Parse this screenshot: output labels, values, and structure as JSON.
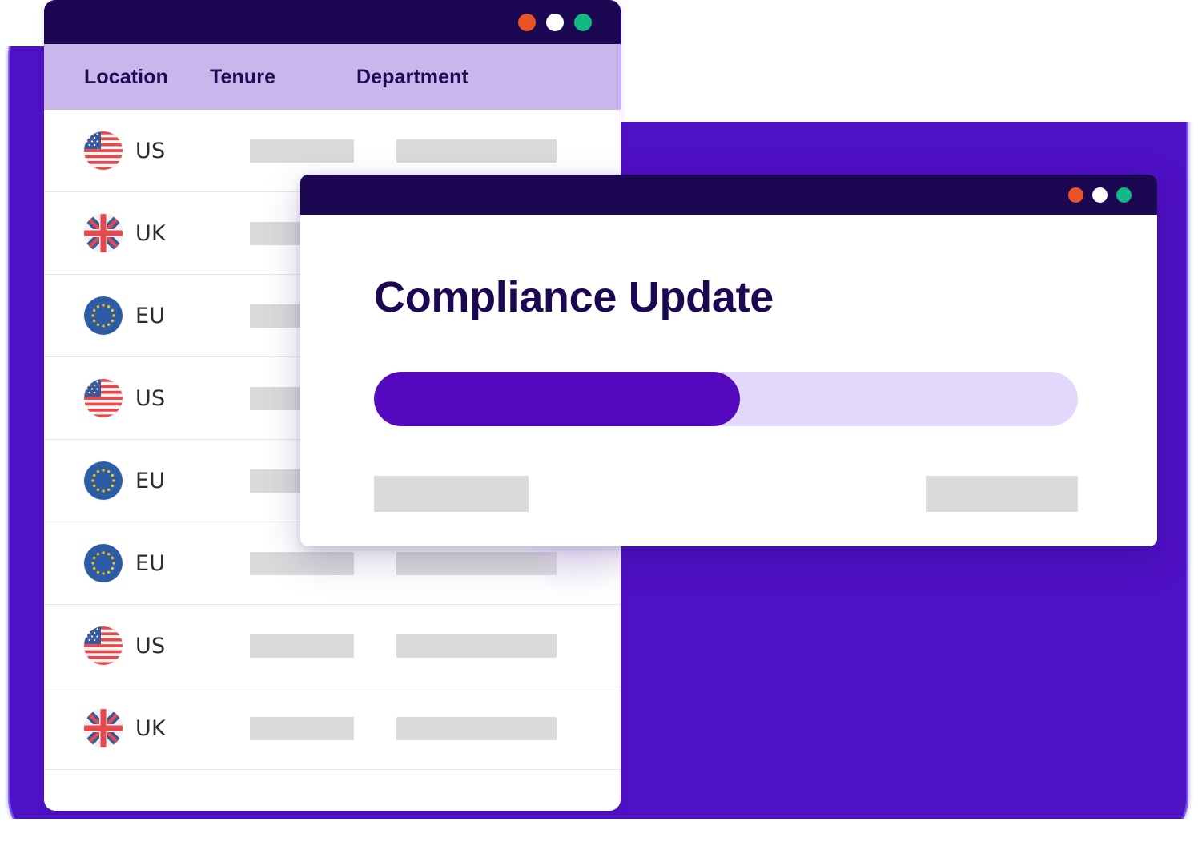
{
  "theme": {
    "accent_purple": "#5409BE",
    "frame_purple": "#4F11C4",
    "titlebar_navy": "#1B0752",
    "header_lavender": "#C9B6EC",
    "progress_track": "#E3D8FC",
    "skeleton_gray": "#DADADA",
    "dot_red": "#EB5424",
    "dot_white": "#FFFFFF",
    "dot_green": "#0FB981"
  },
  "table_window": {
    "titlebar": {
      "close_dot": "close-dot",
      "minimize_dot": "minimize-dot",
      "maximize_dot": "maximize-dot"
    },
    "columns": [
      {
        "key": "location",
        "label": "Location"
      },
      {
        "key": "tenure",
        "label": "Tenure"
      },
      {
        "key": "department",
        "label": "Department"
      }
    ],
    "rows": [
      {
        "flag": "flag-us",
        "location": "US"
      },
      {
        "flag": "flag-uk",
        "location": "UK"
      },
      {
        "flag": "flag-eu",
        "location": "EU"
      },
      {
        "flag": "flag-us",
        "location": "US"
      },
      {
        "flag": "flag-eu",
        "location": "EU"
      },
      {
        "flag": "flag-eu",
        "location": "EU"
      },
      {
        "flag": "flag-us",
        "location": "US"
      },
      {
        "flag": "flag-uk",
        "location": "UK"
      }
    ]
  },
  "modal_window": {
    "titlebar": {
      "close_dot": "close-dot",
      "minimize_dot": "minimize-dot",
      "maximize_dot": "maximize-dot"
    },
    "title": "Compliance Update",
    "progress": {
      "percent": 52,
      "fill_width_css": "52%"
    }
  }
}
